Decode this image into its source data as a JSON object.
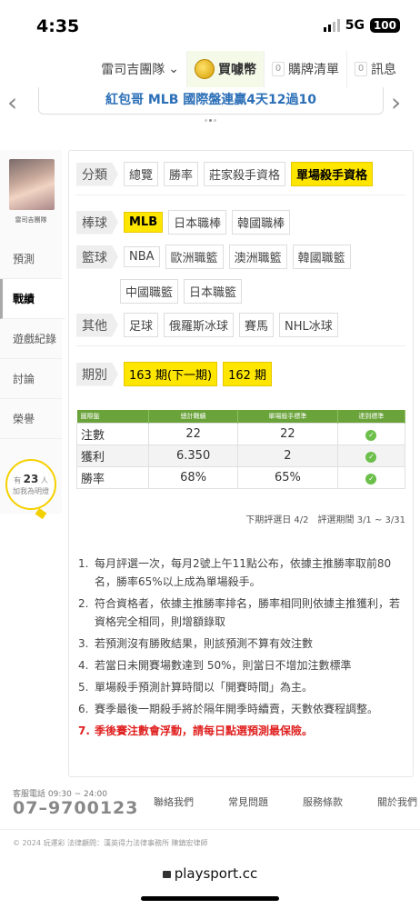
{
  "status_bar": {
    "time": "4:35",
    "network": "5G",
    "battery": "100"
  },
  "top_nav": {
    "team": "雷司吉團隊",
    "buy_coin": "買噱幣",
    "cart_count": "0",
    "cart": "購牌清單",
    "msg_count": "0",
    "messages": "訊息"
  },
  "banner": {
    "text": "紅包哥 MLB 國際盤連贏4天12過10"
  },
  "sidebar": {
    "username": "雷司吉團隊",
    "items": [
      "預測",
      "戰績",
      "遊戲紀錄",
      "討論",
      "榮譽"
    ],
    "fans_prefix": "有",
    "fans_count": "23",
    "fans_unit": "人",
    "fans_suffix": "加我為明燈"
  },
  "filters": {
    "category": {
      "label": "分類",
      "options": [
        "總覽",
        "勝率",
        "莊家殺手資格",
        "單場殺手資格"
      ],
      "selected": "單場殺手資格"
    },
    "baseball": {
      "label": "棒球",
      "options": [
        "MLB",
        "日本職棒",
        "韓國職棒"
      ],
      "selected": "MLB"
    },
    "basketball": {
      "label": "籃球",
      "options": [
        "NBA",
        "歐洲職籃",
        "澳洲職籃",
        "韓國職籃",
        "中國職籃",
        "日本職籃"
      ]
    },
    "other": {
      "label": "其他",
      "options": [
        "足球",
        "俄羅斯冰球",
        "賽馬",
        "NHL冰球"
      ]
    },
    "period": {
      "label": "期別",
      "options": [
        "163 期(下一期)",
        "162 期"
      ]
    }
  },
  "stats_table": {
    "headers": [
      "國際盤",
      "總計戰績",
      "單場殺手標準",
      "達到標準"
    ],
    "rows": [
      {
        "name": "注數",
        "total": "22",
        "standard": "22",
        "met": true
      },
      {
        "name": "獲利",
        "total": "6.350",
        "standard": "2",
        "met": true
      },
      {
        "name": "勝率",
        "total": "68%",
        "standard": "65%",
        "met": true
      }
    ]
  },
  "period_info": "下期評選日 4/2　評選期間 3/1 ~ 3/31",
  "rules": [
    "每月評選一次，每月2號上午11點公布，依據主推勝率取前80名，勝率65%以上成為單場殺手。",
    "符合資格者，依據主推勝率排名，勝率相同則依據主推獲利，若資格完全相同，則增額錄取",
    "若預測沒有勝敗結果，則該預測不算有效注數",
    "若當日未開賽場數達到 50%，則當日不增加注數標準",
    "單場殺手預測計算時間以「開賽時間」為主。",
    "賽季最後一期殺手將於隔年開季時續賣，天數依賽程調整。",
    "季後賽注數會浮動，請每日點選預測最保險。"
  ],
  "footer": {
    "phone_label": "客服電話 09:30 ~ 24:00",
    "phone": "07–9700123",
    "links": [
      "聯絡我們",
      "常見問題",
      "服務條款",
      "關於我們"
    ],
    "copyright": "© 2024 玩運彩 法律顧問：漢英得力法律事務所 陳鎮宏律師",
    "url": "playsport.cc"
  },
  "colors": {
    "accent_yellow": "#ffe600",
    "table_green": "#6aa33a",
    "banner_blue": "#2c6fb7",
    "warn_red": "#e02020"
  }
}
